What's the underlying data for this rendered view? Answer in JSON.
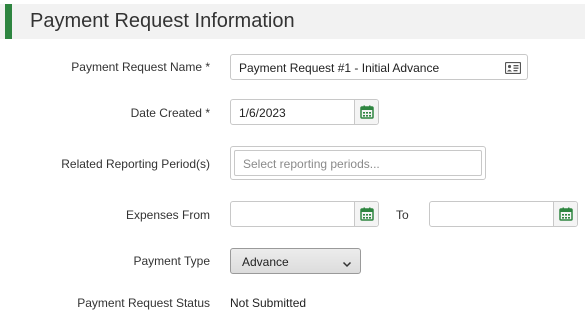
{
  "header": {
    "title": "Payment Request Information",
    "accent_color": "#2e8540"
  },
  "form": {
    "name": {
      "label": "Payment Request Name *",
      "value": "Payment Request #1 - Initial Advance",
      "icon": "id-card-icon"
    },
    "date_created": {
      "label": "Date Created *",
      "value": "1/6/2023",
      "icon": "calendar-icon"
    },
    "reporting_periods": {
      "label": "Related Reporting Period(s)",
      "placeholder": "Select reporting periods..."
    },
    "expenses": {
      "label": "Expenses From",
      "from_value": "",
      "to_label": "To",
      "to_value": "",
      "icon": "calendar-icon"
    },
    "payment_type": {
      "label": "Payment Type",
      "selected": "Advance",
      "icon": "chevron-down-icon"
    },
    "status": {
      "label": "Payment Request Status",
      "value": "Not Submitted"
    }
  },
  "colors": {
    "calendar_icon": "#2e8540",
    "field_border": "#c8c8c8"
  }
}
